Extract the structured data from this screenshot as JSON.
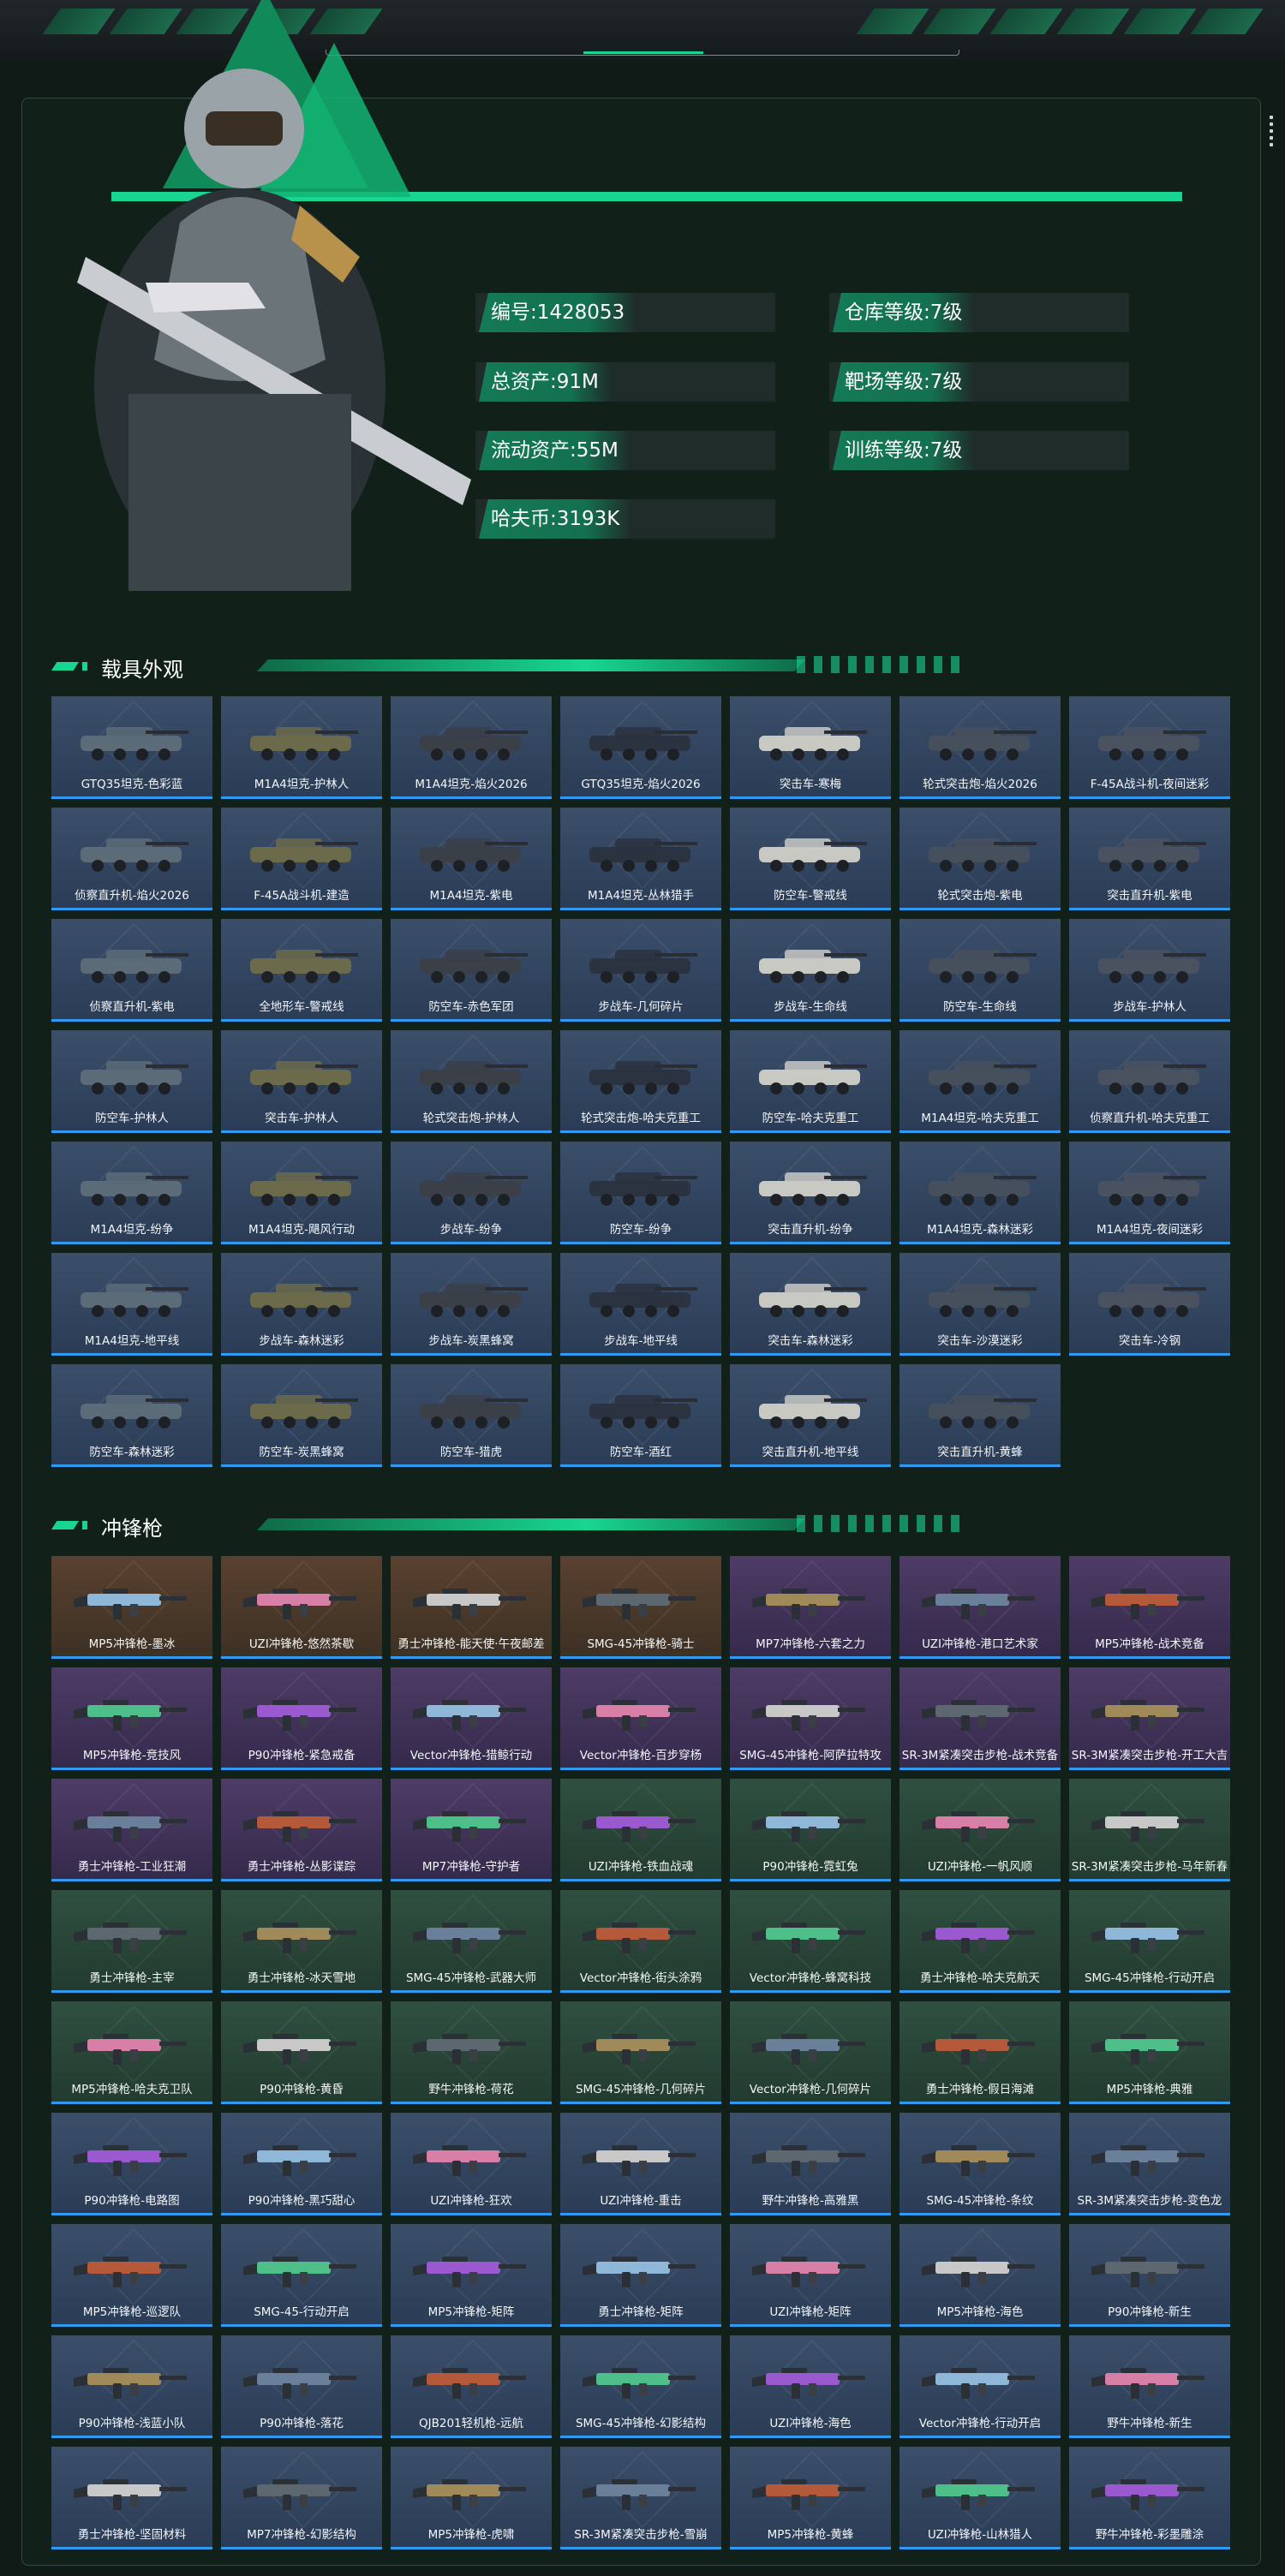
{
  "player": {
    "stats_left": [
      {
        "label": "编号:",
        "value": "1428053"
      },
      {
        "label": "总资产:",
        "value": "91M"
      },
      {
        "label": "流动资产:",
        "value": "55M"
      },
      {
        "label": "哈夫币:",
        "value": "3193K"
      }
    ],
    "stats_right": [
      {
        "label": "仓库等级:",
        "value": "7级"
      },
      {
        "label": "靶场等级:",
        "value": "7级"
      },
      {
        "label": "训练等级:",
        "value": "7级"
      }
    ]
  },
  "vehicles": {
    "title": "载具外观",
    "items": [
      "GTQ35坦克-色彩蓝",
      "M1A4坦克-护林人",
      "M1A4坦克-焰火2026",
      "GTQ35坦克-焰火2026",
      "突击车-寒梅",
      "轮式突击炮-焰火2026",
      "F-45A战斗机-夜间迷彩",
      "侦察直升机-焰火2026",
      "F-45A战斗机-建造",
      "M1A4坦克-紫电",
      "M1A4坦克-丛林猎手",
      "防空车-警戒线",
      "轮式突击炮-紫电",
      "突击直升机-紫电",
      "侦察直升机-紫电",
      "全地形车-警戒线",
      "防空车-赤色军团",
      "步战车-几何碎片",
      "步战车-生命线",
      "防空车-生命线",
      "步战车-护林人",
      "防空车-护林人",
      "突击车-护林人",
      "轮式突击炮-护林人",
      "轮式突击炮-哈夫克重工",
      "防空车-哈夫克重工",
      "M1A4坦克-哈夫克重工",
      "侦察直升机-哈夫克重工",
      "M1A4坦克-纷争",
      "M1A4坦克-飓风行动",
      "步战车-纷争",
      "防空车-纷争",
      "突击直升机-纷争",
      "M1A4坦克-森林迷彩",
      "M1A4坦克-夜间迷彩",
      "M1A4坦克-地平线",
      "步战车-森林迷彩",
      "步战车-炭黑蜂窝",
      "步战车-地平线",
      "突击车-森林迷彩",
      "突击车-沙漠迷彩",
      "突击车-冷钢",
      "防空车-森林迷彩",
      "防空车-炭黑蜂窝",
      "防空车-猎虎",
      "防空车-酒红",
      "突击直升机-地平线",
      "突击直升机-黄蜂"
    ],
    "rarity": "blue"
  },
  "smgs": {
    "title": "冲锋枪",
    "items": [
      {
        "name": "MP5冲锋枪-墨冰",
        "r": "orange"
      },
      {
        "name": "UZI冲锋枪-悠然茶歇",
        "r": "orange"
      },
      {
        "name": "勇士冲锋枪-能天使·午夜邮差",
        "r": "orange"
      },
      {
        "name": "SMG-45冲锋枪-骑士",
        "r": "orange"
      },
      {
        "name": "MP7冲锋枪-六套之力",
        "r": "purple"
      },
      {
        "name": "UZI冲锋枪-港口艺术家",
        "r": "purple"
      },
      {
        "name": "MP5冲锋枪-战术竞备",
        "r": "purple"
      },
      {
        "name": "MP5冲锋枪-竞技风",
        "r": "purple"
      },
      {
        "name": "P90冲锋枪-紧急戒备",
        "r": "purple"
      },
      {
        "name": "Vector冲锋枪-猎鲸行动",
        "r": "purple"
      },
      {
        "name": "Vector冲锋枪-百步穿杨",
        "r": "purple"
      },
      {
        "name": "SMG-45冲锋枪-阿萨拉特攻",
        "r": "purple"
      },
      {
        "name": "SR-3M紧凑突击步枪-战术竞备",
        "r": "purple"
      },
      {
        "name": "SR-3M紧凑突击步枪-开工大吉",
        "r": "purple"
      },
      {
        "name": "勇士冲锋枪-工业狂潮",
        "r": "purple"
      },
      {
        "name": "勇士冲锋枪-丛影谍踪",
        "r": "purple"
      },
      {
        "name": "MP7冲锋枪-守护者",
        "r": "purple"
      },
      {
        "name": "UZI冲锋枪-铁血战魂",
        "r": "green"
      },
      {
        "name": "P90冲锋枪-霓虹兔",
        "r": "green"
      },
      {
        "name": "UZI冲锋枪-一帆风顺",
        "r": "green"
      },
      {
        "name": "SR-3M紧凑突击步枪-马年新春",
        "r": "green"
      },
      {
        "name": "勇士冲锋枪-主宰",
        "r": "green"
      },
      {
        "name": "勇士冲锋枪-冰天雪地",
        "r": "green"
      },
      {
        "name": "SMG-45冲锋枪-武器大师",
        "r": "green"
      },
      {
        "name": "Vector冲锋枪-街头涂鸦",
        "r": "green"
      },
      {
        "name": "Vector冲锋枪-蜂窝科技",
        "r": "green"
      },
      {
        "name": "勇士冲锋枪-哈夫克航天",
        "r": "green"
      },
      {
        "name": "SMG-45冲锋枪-行动开启",
        "r": "green"
      },
      {
        "name": "MP5冲锋枪-哈夫克卫队",
        "r": "green"
      },
      {
        "name": "P90冲锋枪-黄昏",
        "r": "green"
      },
      {
        "name": "野牛冲锋枪-荷花",
        "r": "green"
      },
      {
        "name": "SMG-45冲锋枪-几何碎片",
        "r": "green"
      },
      {
        "name": "Vector冲锋枪-几何碎片",
        "r": "green"
      },
      {
        "name": "勇士冲锋枪-假日海滩",
        "r": "green"
      },
      {
        "name": "MP5冲锋枪-典雅",
        "r": "green"
      },
      {
        "name": "P90冲锋枪-电路图",
        "r": "blue"
      },
      {
        "name": "P90冲锋枪-黑巧甜心",
        "r": "blue"
      },
      {
        "name": "UZI冲锋枪-狂欢",
        "r": "blue"
      },
      {
        "name": "UZI冲锋枪-重击",
        "r": "blue"
      },
      {
        "name": "野牛冲锋枪-高雅黑",
        "r": "blue"
      },
      {
        "name": "SMG-45冲锋枪-条纹",
        "r": "blue"
      },
      {
        "name": "SR-3M紧凑突击步枪-变色龙",
        "r": "blue"
      },
      {
        "name": "MP5冲锋枪-巡逻队",
        "r": "blue"
      },
      {
        "name": "SMG-45-行动开启",
        "r": "blue"
      },
      {
        "name": "MP5冲锋枪-矩阵",
        "r": "blue"
      },
      {
        "name": "勇士冲锋枪-矩阵",
        "r": "blue"
      },
      {
        "name": "UZI冲锋枪-矩阵",
        "r": "blue"
      },
      {
        "name": "MP5冲锋枪-海色",
        "r": "blue"
      },
      {
        "name": "P90冲锋枪-新生",
        "r": "blue"
      },
      {
        "name": "P90冲锋枪-浅蓝小队",
        "r": "blue"
      },
      {
        "name": "P90冲锋枪-落花",
        "r": "blue"
      },
      {
        "name": "QJB201轻机枪-远航",
        "r": "blue"
      },
      {
        "name": "SMG-45冲锋枪-幻影结构",
        "r": "blue"
      },
      {
        "name": "UZI冲锋枪-海色",
        "r": "blue"
      },
      {
        "name": "Vector冲锋枪-行动开启",
        "r": "blue"
      },
      {
        "name": "野牛冲锋枪-新生",
        "r": "blue"
      },
      {
        "name": "勇士冲锋枪-坚固材料",
        "r": "blue"
      },
      {
        "name": "MP7冲锋枪-幻影结构",
        "r": "blue"
      },
      {
        "name": "MP5冲锋枪-虎啸",
        "r": "blue"
      },
      {
        "name": "SR-3M紧凑突击步枪-雪崩",
        "r": "blue"
      },
      {
        "name": "MP5冲锋枪-黄蜂",
        "r": "blue"
      },
      {
        "name": "UZI冲锋枪-山林猎人",
        "r": "blue"
      },
      {
        "name": "野牛冲锋枪-彩墨雕涂",
        "r": "blue"
      }
    ]
  },
  "colors": {
    "accent": "#18d691",
    "panel": "#12201a"
  }
}
